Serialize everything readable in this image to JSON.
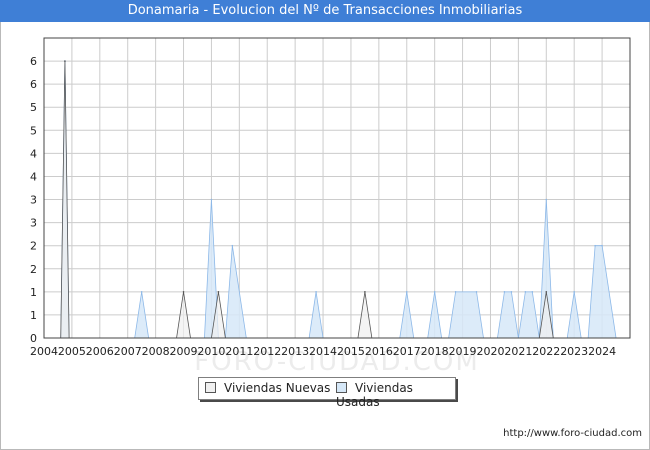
{
  "title": "Donamaria - Evolucion del Nº de Transacciones Inmobiliarias",
  "footer": "http://www.foro-ciudad.com",
  "watermark": "FORO-CIUDAD.COM",
  "colors": {
    "title_bg": "#3f7fd6",
    "nuevas_fill": "#f0f0f0",
    "nuevas_line": "#555555",
    "usadas_fill": "#d6e8f8",
    "usadas_line": "#8cb8e8",
    "grid": "#cccccc"
  },
  "chart_data": {
    "type": "area",
    "title": "Donamaria - Evolucion del Nº de Transacciones Inmobiliarias",
    "xlabel": "",
    "ylabel": "",
    "grid": true,
    "legend_position": "bottom",
    "x_ticks": [
      "2004",
      "2005",
      "2006",
      "2007",
      "2008",
      "2009",
      "2010",
      "2011",
      "2012",
      "2013",
      "2014",
      "2015",
      "2016",
      "2017",
      "2018",
      "2019",
      "2020",
      "2021",
      "2022",
      "2023",
      "2024"
    ],
    "y_ticks": [
      "0",
      "1",
      "1",
      "2",
      "2",
      "3",
      "3",
      "4",
      "4",
      "5",
      "5",
      "6",
      "6"
    ],
    "y_tick_values": [
      0,
      0.5,
      1,
      1.5,
      2,
      2.5,
      3,
      3.5,
      4,
      4.5,
      5,
      5.5,
      6
    ],
    "xlim": [
      2004,
      2025
    ],
    "ylim": [
      0,
      6.5
    ],
    "series": [
      {
        "name": "Viviendas Nuevas",
        "points": [
          [
            2004.6,
            0
          ],
          [
            2004.75,
            6
          ],
          [
            2004.9,
            0
          ],
          [
            2008.75,
            0
          ],
          [
            2009.0,
            1
          ],
          [
            2009.25,
            0
          ],
          [
            2010.0,
            0
          ],
          [
            2010.25,
            1
          ],
          [
            2010.5,
            0
          ],
          [
            2015.25,
            0
          ],
          [
            2015.5,
            1
          ],
          [
            2015.75,
            0
          ],
          [
            2021.75,
            0
          ],
          [
            2022.0,
            1
          ],
          [
            2022.25,
            0
          ]
        ]
      },
      {
        "name": "Viviendas Usadas",
        "points": [
          [
            2004.6,
            0
          ],
          [
            2004.75,
            6
          ],
          [
            2004.9,
            0
          ],
          [
            2007.25,
            0
          ],
          [
            2007.5,
            1
          ],
          [
            2007.75,
            0
          ],
          [
            2009.75,
            0
          ],
          [
            2010.0,
            3
          ],
          [
            2010.25,
            0
          ],
          [
            2010.5,
            0
          ],
          [
            2010.75,
            2
          ],
          [
            2011.25,
            0
          ],
          [
            2013.5,
            0
          ],
          [
            2013.75,
            1
          ],
          [
            2014.0,
            0
          ],
          [
            2016.75,
            0
          ],
          [
            2017.0,
            1
          ],
          [
            2017.25,
            0
          ],
          [
            2017.75,
            0
          ],
          [
            2018.0,
            1
          ],
          [
            2018.25,
            0
          ],
          [
            2018.5,
            0
          ],
          [
            2018.75,
            1
          ],
          [
            2019.5,
            1
          ],
          [
            2019.75,
            0
          ],
          [
            2020.25,
            0
          ],
          [
            2020.5,
            1
          ],
          [
            2020.75,
            1
          ],
          [
            2021.0,
            0
          ],
          [
            2021.25,
            1
          ],
          [
            2021.5,
            1
          ],
          [
            2021.75,
            0
          ],
          [
            2022.0,
            3
          ],
          [
            2022.25,
            0
          ],
          [
            2022.75,
            0
          ],
          [
            2023.0,
            1
          ],
          [
            2023.25,
            0
          ],
          [
            2023.5,
            0
          ],
          [
            2023.75,
            2
          ],
          [
            2024.0,
            2
          ],
          [
            2024.5,
            0
          ]
        ]
      }
    ]
  }
}
